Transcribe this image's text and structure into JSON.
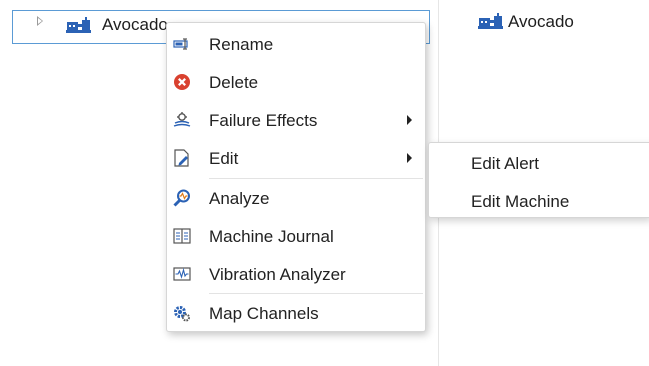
{
  "tree": {
    "node_label": "Avocado",
    "node_icon": "machine-icon"
  },
  "details": {
    "title": "Avocado",
    "icon": "machine-icon"
  },
  "context_menu": {
    "items": [
      {
        "label": "Rename",
        "icon": "rename-icon"
      },
      {
        "label": "Delete",
        "icon": "delete-icon"
      },
      {
        "label": "Failure Effects",
        "icon": "failure-effects-icon",
        "submenu": true
      },
      {
        "label": "Edit",
        "icon": "edit-icon",
        "submenu": true
      },
      {
        "label": "Analyze",
        "icon": "analyze-icon"
      },
      {
        "label": "Machine Journal",
        "icon": "journal-icon"
      },
      {
        "label": "Vibration Analyzer",
        "icon": "vibration-icon"
      },
      {
        "label": "Map Channels",
        "icon": "map-channels-icon"
      }
    ]
  },
  "edit_submenu": {
    "items": [
      {
        "label": "Edit Alert"
      },
      {
        "label": "Edit Machine"
      }
    ]
  },
  "colors": {
    "selection_border": "#5b9bd5",
    "delete_red": "#d9412f",
    "icon_blue": "#2b62b5"
  }
}
